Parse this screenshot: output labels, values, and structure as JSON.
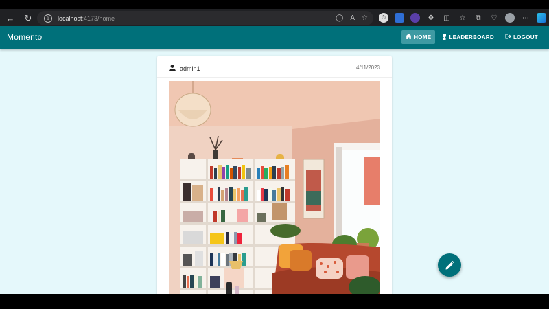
{
  "browser": {
    "url_host": "localhost",
    "url_path": ":4173/home",
    "icons": [
      "back-icon",
      "refresh-icon",
      "info-icon",
      "read-aloud-icon",
      "favorite-icon",
      "extensions-icon",
      "split-screen-icon",
      "favorites-bar-icon",
      "collections-icon",
      "heart-icon",
      "profile-avatar",
      "more-icon",
      "edge-copilot-icon"
    ]
  },
  "app": {
    "brand": "Momento",
    "nav": [
      {
        "label": "HOME",
        "icon": "home-icon",
        "active": true
      },
      {
        "label": "LEADERBOARD",
        "icon": "trophy-icon",
        "active": false
      },
      {
        "label": "LOGOUT",
        "icon": "logout-icon",
        "active": false
      }
    ],
    "colors": {
      "primary": "#00707a",
      "background": "#e5f8fb",
      "active_nav": "#3e9aa3"
    }
  },
  "post": {
    "username": "admin1",
    "date": "4/11/2023",
    "image_description_icon": "photo-living-room"
  },
  "fab": {
    "icon": "pencil-icon"
  }
}
